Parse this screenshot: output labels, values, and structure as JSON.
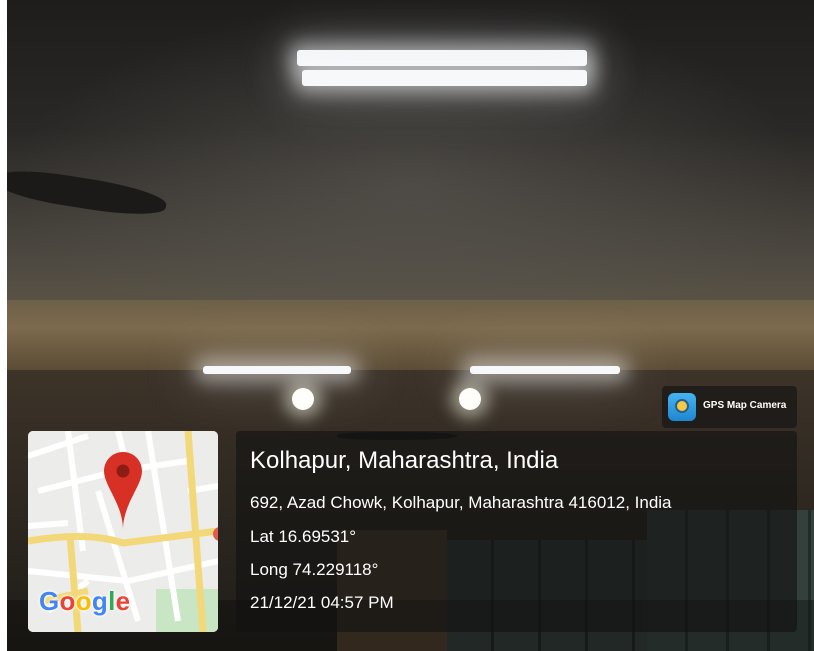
{
  "location": {
    "title": "Kolhapur, Maharashtra, India",
    "address": "692, Azad Chowk, Kolhapur, Maharashtra 416012, India",
    "latitude": "Lat 16.69531°",
    "longitude": "Long 74.229118°",
    "datetime": "21/12/21 04:57 PM"
  },
  "app_badge": {
    "name": "GPS Map Camera",
    "icon": "gps-map-camera-icon"
  },
  "map": {
    "logo_letters": [
      "G",
      "o",
      "o",
      "g",
      "l",
      "e"
    ],
    "logo_colors": [
      "#4285F4",
      "#EA4335",
      "#FBBC05",
      "#4285F4",
      "#34A853",
      "#EA4335"
    ],
    "pin_icon": "map-pin-icon",
    "pin_color": "#D93025"
  },
  "colors": {
    "overlay": "rgba(18,18,18,0.62)",
    "text": "#ffffff"
  }
}
